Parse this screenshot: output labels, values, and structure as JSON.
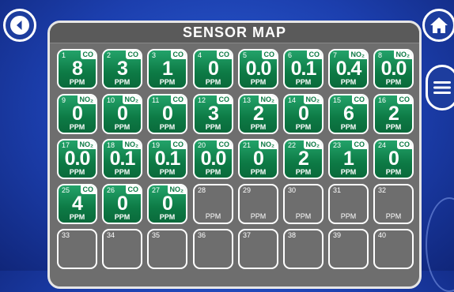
{
  "title": "SENSOR MAP",
  "nav": {
    "back_icon": "chevron-left-icon",
    "home_icon": "home-icon",
    "menu_icon": "hamburger-icon"
  },
  "colors": {
    "active_tile": "#0d7a45",
    "empty_tile": "#6e6e6e",
    "background": "#1c3fae"
  },
  "sensors": [
    {
      "id": "1",
      "gas": "CO",
      "value": "8",
      "unit": "PPM"
    },
    {
      "id": "2",
      "gas": "CO",
      "value": "3",
      "unit": "PPM"
    },
    {
      "id": "3",
      "gas": "CO",
      "value": "1",
      "unit": "PPM"
    },
    {
      "id": "4",
      "gas": "CO",
      "value": "0",
      "unit": "PPM"
    },
    {
      "id": "5",
      "gas": "CO",
      "value": "0.0",
      "unit": "PPM"
    },
    {
      "id": "6",
      "gas": "CO",
      "value": "0.1",
      "unit": "PPM"
    },
    {
      "id": "7",
      "gas": "NO₂",
      "value": "0.4",
      "unit": "PPM"
    },
    {
      "id": "8",
      "gas": "NO₂",
      "value": "0.0",
      "unit": "PPM"
    },
    {
      "id": "9",
      "gas": "NO₂",
      "value": "0",
      "unit": "PPM"
    },
    {
      "id": "10",
      "gas": "NO₂",
      "value": "0",
      "unit": "PPM"
    },
    {
      "id": "11",
      "gas": "CO",
      "value": "0",
      "unit": "PPM"
    },
    {
      "id": "12",
      "gas": "CO",
      "value": "3",
      "unit": "PPM"
    },
    {
      "id": "13",
      "gas": "NO₂",
      "value": "2",
      "unit": "PPM"
    },
    {
      "id": "14",
      "gas": "NO₂",
      "value": "0",
      "unit": "PPM"
    },
    {
      "id": "15",
      "gas": "CO",
      "value": "6",
      "unit": "PPM"
    },
    {
      "id": "16",
      "gas": "CO",
      "value": "2",
      "unit": "PPM"
    },
    {
      "id": "17",
      "gas": "NO₂",
      "value": "0.0",
      "unit": "PPM"
    },
    {
      "id": "18",
      "gas": "NO₂",
      "value": "0.1",
      "unit": "PPM"
    },
    {
      "id": "19",
      "gas": "CO",
      "value": "0.1",
      "unit": "PPM"
    },
    {
      "id": "20",
      "gas": "CO",
      "value": "0.0",
      "unit": "PPM"
    },
    {
      "id": "21",
      "gas": "NO₂",
      "value": "0",
      "unit": "PPM"
    },
    {
      "id": "22",
      "gas": "NO₂",
      "value": "2",
      "unit": "PPM"
    },
    {
      "id": "23",
      "gas": "CO",
      "value": "1",
      "unit": "PPM"
    },
    {
      "id": "24",
      "gas": "CO",
      "value": "0",
      "unit": "PPM"
    },
    {
      "id": "25",
      "gas": "CO",
      "value": "4",
      "unit": "PPM"
    },
    {
      "id": "26",
      "gas": "CO",
      "value": "0",
      "unit": "PPM"
    },
    {
      "id": "27",
      "gas": "NO₂",
      "value": "0",
      "unit": "PPM"
    },
    {
      "id": "28",
      "gas": "",
      "value": "",
      "unit": "PPM"
    },
    {
      "id": "29",
      "gas": "",
      "value": "",
      "unit": "PPM"
    },
    {
      "id": "30",
      "gas": "",
      "value": "",
      "unit": "PPM"
    },
    {
      "id": "31",
      "gas": "",
      "value": "",
      "unit": "PPM"
    },
    {
      "id": "32",
      "gas": "",
      "value": "",
      "unit": "PPM"
    },
    {
      "id": "33",
      "gas": "",
      "value": "",
      "unit": ""
    },
    {
      "id": "34",
      "gas": "",
      "value": "",
      "unit": ""
    },
    {
      "id": "35",
      "gas": "",
      "value": "",
      "unit": ""
    },
    {
      "id": "36",
      "gas": "",
      "value": "",
      "unit": ""
    },
    {
      "id": "37",
      "gas": "",
      "value": "",
      "unit": ""
    },
    {
      "id": "38",
      "gas": "",
      "value": "",
      "unit": ""
    },
    {
      "id": "39",
      "gas": "",
      "value": "",
      "unit": ""
    },
    {
      "id": "40",
      "gas": "",
      "value": "",
      "unit": ""
    }
  ]
}
